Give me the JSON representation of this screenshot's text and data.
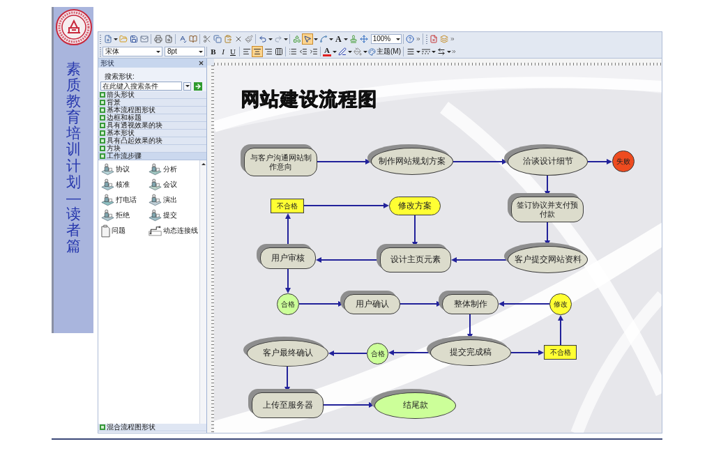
{
  "banner": {
    "title": "素质教育培训计划—读者篇"
  },
  "toolbar": {
    "tools": [
      {
        "kind": "pointer",
        "selected": true
      },
      {
        "kind": "connector",
        "selected": false
      },
      {
        "kind": "text",
        "label": "A",
        "selected": false
      }
    ],
    "zoom": "100%",
    "font": "宋体",
    "font_size": "8pt",
    "text_styles": [
      "B",
      "I",
      "U"
    ],
    "alignment": [
      {
        "kind": "left",
        "selected": false
      },
      {
        "kind": "center",
        "selected": true
      },
      {
        "kind": "right",
        "selected": false
      }
    ],
    "font_color": "A",
    "theme_button": "主题(M)"
  },
  "shapes_panel": {
    "title": "形状",
    "search": {
      "label": "搜索形状:",
      "placeholder": "在此键入搜索条件"
    },
    "stencils": [
      {
        "label": "箭头形状",
        "expanded": false
      },
      {
        "label": "背景",
        "expanded": false
      },
      {
        "label": "基本流程图形状",
        "expanded": false
      },
      {
        "label": "边框和标题",
        "expanded": false
      },
      {
        "label": "具有透视效果的块",
        "expanded": false
      },
      {
        "label": "基本形状",
        "expanded": false
      },
      {
        "label": "具有凸起效果的块",
        "expanded": false
      },
      {
        "label": "方块",
        "expanded": false
      },
      {
        "label": "工作流步骤",
        "expanded": true,
        "shapes": [
          "协议",
          "分析",
          "核准",
          "会议",
          "打电话",
          "演出",
          "拒绝",
          "提交",
          "问题",
          "动态连接线"
        ]
      },
      {
        "label": "混合流程图形状",
        "expanded": false
      }
    ]
  },
  "canvas": {
    "title": "网站建设流程图",
    "nodes": [
      {
        "kind": "terminator",
        "text": "与客户沟通网站制作意向",
        "color": "#dcdccc",
        "shadow": true
      },
      {
        "kind": "ellipse",
        "text": "制作网站规划方案",
        "color": "#dcdccc",
        "shadow": true
      },
      {
        "kind": "ellipse",
        "text": "洽谈设计细节",
        "color": "#dcdccc",
        "shadow": true
      },
      {
        "kind": "circle",
        "text": "失败",
        "color": "#ee4b1f",
        "shadow": false
      },
      {
        "kind": "rect",
        "text": "不合格",
        "color": "#ffff33",
        "shadow": false
      },
      {
        "kind": "terminator",
        "text": "修改方案",
        "color": "#ffff33",
        "shadow": false
      },
      {
        "kind": "terminator",
        "text": "签订协议并支付预付款",
        "color": "#dcdccc",
        "shadow": true
      },
      {
        "kind": "terminator",
        "text": "用户审核",
        "color": "#dcdccc",
        "shadow": true
      },
      {
        "kind": "terminator",
        "text": "设计主页元素",
        "color": "#dcdccc",
        "shadow": true
      },
      {
        "kind": "ellipse",
        "text": "客户提交网站资料",
        "color": "#dcdccc",
        "shadow": true
      },
      {
        "kind": "circle",
        "text": "合格",
        "color": "#ccff99",
        "shadow": false
      },
      {
        "kind": "terminator",
        "text": "用户确认",
        "color": "#dcdccc",
        "shadow": true
      },
      {
        "kind": "terminator",
        "text": "整体制作",
        "color": "#dcdccc",
        "shadow": true
      },
      {
        "kind": "circle",
        "text": "修改",
        "color": "#ffff33",
        "shadow": false
      },
      {
        "kind": "ellipse",
        "text": "客户最终确认",
        "color": "#dcdccc",
        "shadow": true
      },
      {
        "kind": "circle",
        "text": "合格",
        "color": "#ccff99",
        "shadow": false
      },
      {
        "kind": "ellipse",
        "text": "提交完成稿",
        "color": "#dcdccc",
        "shadow": true
      },
      {
        "kind": "rect",
        "text": "不合格",
        "color": "#ffff33",
        "shadow": false
      },
      {
        "kind": "terminator",
        "text": "上传至服务器",
        "color": "#dcdccc",
        "shadow": true
      },
      {
        "kind": "ellipse",
        "text": "结尾款",
        "color": "#ccff99",
        "shadow": true
      }
    ]
  }
}
